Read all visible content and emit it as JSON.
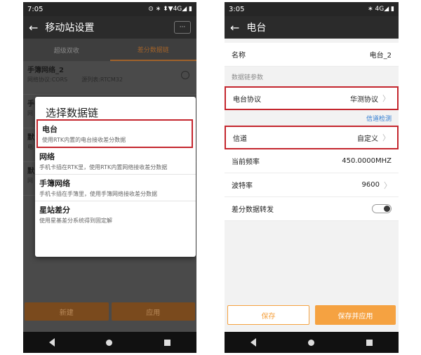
{
  "left": {
    "status": {
      "time": "7:05",
      "icons": "⊙ ∗ ⬍▼4G◢ ▮"
    },
    "title": "移动站设置",
    "more_label": "···",
    "tabs": [
      "超级双收",
      "差分数据链"
    ],
    "network_items": [
      {
        "title": "手簿网络_2",
        "sub1": "网络协议:CORS",
        "sub2": "源列表:RTCM32"
      },
      {
        "title": "手",
        "sub1": "网",
        "sub2": ""
      },
      {
        "title": "默",
        "sub1": "电",
        "sub2": ""
      },
      {
        "title": "默",
        "sub1": "网",
        "sub2": ""
      }
    ],
    "dialog": {
      "title": "选择数据链",
      "options": [
        {
          "title": "电台",
          "desc": "使用RTK内置的电台接收差分数据"
        },
        {
          "title": "网络",
          "desc": "手机卡插在RTK里，使用RTK内置网络接收差分数据"
        },
        {
          "title": "手簿网络",
          "desc": "手机卡插在手簿里，使用手簿网络接收差分数据"
        },
        {
          "title": "星站差分",
          "desc": "使用星基差分系统得到固定解"
        }
      ]
    },
    "buttons": {
      "new": "新建",
      "apply": "应用"
    }
  },
  "right": {
    "status": {
      "time": "3:05",
      "icons": "∗ 4G◢ ▮"
    },
    "title": "电台",
    "rows": {
      "name": {
        "label": "名称",
        "value": "电台_2"
      },
      "section": "数据链参数",
      "protocol": {
        "label": "电台协议",
        "value": "华测协议"
      },
      "channel_check": "信道检测",
      "channel": {
        "label": "信道",
        "value": "自定义"
      },
      "freq": {
        "label": "当前频率",
        "value": "450.0000MHZ"
      },
      "baud": {
        "label": "波特率",
        "value": "9600"
      },
      "forward": {
        "label": "差分数据转发",
        "enabled": false
      }
    },
    "buttons": {
      "save": "保存",
      "save_apply": "保存并应用"
    }
  },
  "colors": {
    "accent": "#f5a241",
    "highlight": "#c4262e",
    "link": "#2e7bd1"
  }
}
